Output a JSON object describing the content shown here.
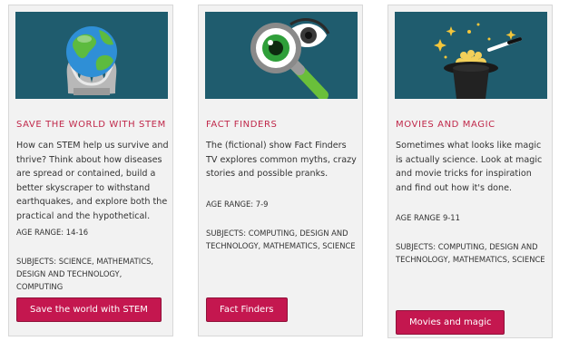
{
  "cards": [
    {
      "title": "SAVE THE WORLD WITH STEM",
      "description": "How can STEM help us survive and thrive? Think about how diseases are spread or contained, build a better skyscraper to withstand earthquakes, and explore both the practical and the hypothetical.",
      "age_range": "AGE RANGE: 14-16",
      "subjects": "SUBJECTS: SCIENCE, MATHEMATICS, DESIGN AND TECHNOLOGY, COMPUTING",
      "button_label": "Save the world with STEM",
      "icon": "globe-in-hands-icon"
    },
    {
      "title": "FACT FINDERS",
      "description": "The (fictional) show Fact Finders TV explores common myths, crazy stories and possible pranks.",
      "age_range": "AGE RANGE: 7-9",
      "subjects": "SUBJECTS: COMPUTING, DESIGN AND TECHNOLOGY, MATHEMATICS, SCIENCE",
      "button_label": "Fact Finders",
      "icon": "magnifying-glass-eye-icon"
    },
    {
      "title": "MOVIES AND MAGIC",
      "description": "Sometimes what looks like magic is actually science. Look at magic and movie tricks for inspiration and find out how it's done.",
      "age_range": "AGE RANGE 9-11",
      "subjects": "SUBJECTS: COMPUTING, DESIGN AND TECHNOLOGY, MATHEMATICS, SCIENCE",
      "button_label": "Movies and magic",
      "icon": "magic-hat-wand-icon"
    }
  ],
  "colors": {
    "accent": "#c4174f",
    "title": "#c0284a",
    "hero_bg": "#1f5c6e",
    "card_bg": "#f2f2f2"
  }
}
